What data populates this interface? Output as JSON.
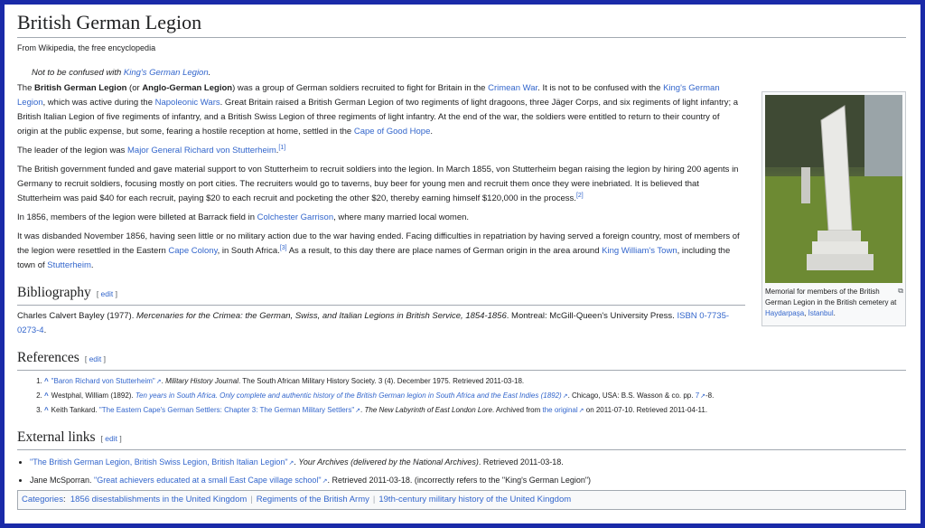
{
  "title": "British German Legion",
  "tagline": "From Wikipedia, the free encyclopedia",
  "hatnote": {
    "prefix": "Not to be confused with ",
    "link": "King's German Legion",
    "suffix": "."
  },
  "p1": {
    "t1": "The ",
    "b1": "British German Legion",
    "t2": " (or ",
    "b2": "Anglo-German Legion",
    "t3": ") was a group of German soldiers recruited to fight for Britain in the ",
    "l1": "Crimean War",
    "t4": ". It is not to be confused with the ",
    "l2": "King's German Legion",
    "t5": ", which was active during the ",
    "l3": "Napoleonic Wars",
    "t6": ". Great Britain raised a British German Legion of two regiments of light dragoons, three Jäger Corps, and six regiments of light infantry; a British Italian Legion of five regiments of infantry, and a British Swiss Legion of three regiments of light infantry. At the end of the war, the soldiers were entitled to return to their country of origin at the public expense, but some, fearing a hostile reception at home, settled in the ",
    "l4": "Cape of Good Hope",
    "t7": "."
  },
  "p2": {
    "t1": "The leader of the legion was ",
    "l1": "Major General",
    "t2": " ",
    "l2": "Richard von Stutterheim",
    "t3": ".",
    "ref": "[1]"
  },
  "p3": {
    "t1": "The British government funded and gave material support to von Stutterheim to recruit soldiers into the legion. In March 1855, von Stutterheim began raising the legion by hiring 200 agents in Germany to recruit soldiers, focusing mostly on port cities. The recruiters would go to taverns, buy beer for young men and recruit them once they were inebriated. It is believed that Stutterheim was paid $40 for each recruit, paying $20 to each recruit and pocketing the other $20, thereby earning himself $120,000 in the process.",
    "ref": "[2]"
  },
  "p4": {
    "t1": "In 1856, members of the legion were billeted at Barrack field in ",
    "l1": "Colchester Garrison",
    "t2": ", where many married local women."
  },
  "p5": {
    "t1": "It was disbanded November 1856, having seen little or no military action due to the war having ended. Facing difficulties in repatriation by having served a foreign country, most of members of the legion were resettled in the Eastern ",
    "l1": "Cape Colony",
    "t2": ", in South Africa.",
    "ref": "[3]",
    "t3": " As a result, to this day there are place names of German origin in the area around ",
    "l2": "King William's Town",
    "t4": ", including the town of ",
    "l3": "Stutterheim",
    "t5": "."
  },
  "edit_label": "edit",
  "bibliography": {
    "heading": "Bibliography",
    "t1": "Charles Calvert Bayley (1977). ",
    "title": "Mercenaries for the Crimea: the German, Swiss, and Italian Legions in British Service, 1854-1856",
    "t2": ". Montreal: McGill-Queen's University Press. ",
    "isbn_label": "ISBN",
    "t3": " ",
    "isbn": "0-7735-0273-4",
    "t4": "."
  },
  "references": {
    "heading": "References",
    "caret": "^",
    "items": [
      {
        "link": "\"Baron Richard von Stutterheim\"",
        "t1": ". ",
        "i1": "Military History Journal",
        "t2": ". The South African Military History Society. 3 (4). December 1975. Retrieved 2011-03-18."
      },
      {
        "t0": "Westphal, William (1892). ",
        "link": "Ten years in South Africa. Only complete and authentic history of the British German legion in South Africa and the East Indies (1892)",
        "t1": ". Chicago, USA: B.S. Wasson & co. pp. ",
        "page": "7",
        "t2": "-8."
      },
      {
        "t0": "Keith Tankard. ",
        "link": "\"The Eastern Cape's German Settlers: Chapter 3: The German Military Settlers\"",
        "t1": ". ",
        "i1": "The New Labyrinth of East London Lore",
        "t2": ". Archived from ",
        "link2": "the original",
        "t3": " on 2011-07-10. Retrieved 2011-04-11."
      }
    ]
  },
  "external": {
    "heading": "External links",
    "items": [
      {
        "link": "\"The British German Legion, British Swiss Legion, British Italian Legion\"",
        "t1": ". ",
        "i1": "Your Archives (delivered by the National Archives)",
        "t2": ". Retrieved 2011-03-18."
      },
      {
        "t0": "Jane McSporran. ",
        "link": "\"Great achievers educated at a small East Cape village school\"",
        "t1": ". Retrieved 2011-03-18. (incorrectly refers to the \"King's German Legion\")"
      }
    ]
  },
  "thumb": {
    "caption": "Memorial for members of the British German Legion in the British cemetery at ",
    "l1": "Haydarpaşa",
    "t1": ", ",
    "l2": "İstanbul",
    "t2": "."
  },
  "categories": {
    "label": "Categories",
    "colon": ":",
    "items": [
      "1856 disestablishments in the United Kingdom",
      "Regiments of the British Army",
      "19th-century military history of the United Kingdom"
    ]
  },
  "colors": {
    "link": "#3366cc",
    "frame": "#1a2aa8",
    "text": "#202122"
  },
  "icons": {
    "external_link": "external-link-icon",
    "magnify": "magnify-icon"
  }
}
